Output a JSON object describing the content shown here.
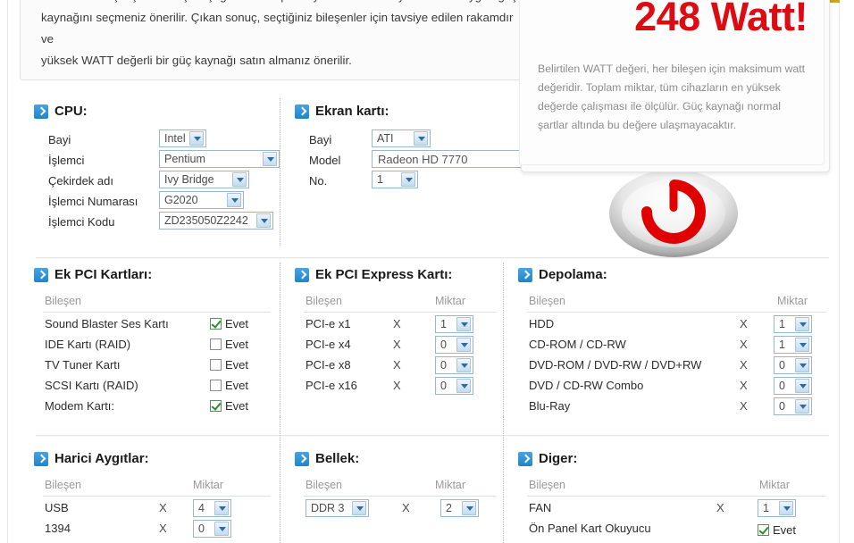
{
  "intro": {
    "text": "sorunlarla karşılaşmamak için aşağıdaki hesaplamayı kullanarak ihtiyacınıza en uygun güç\nkaynağını seçmeniz önerilir. Çıkan sonuç, seçtiğiniz bileşenler için tavsiye edilen rakamdır ve\nyüksek WATT değerli bir güç kaynağı satın almanız önerilir."
  },
  "result": {
    "value": "248 Watt!",
    "note": "Belirtilen WATT değeri, her bileşen için maksimum watt değeridir. Toplam miktar, tüm cihazların en yüksek değerde çalışması ile ölçülür. Güç kaynağı normal şartlar altında bu değere ulaşmayacaktır.",
    "accent_color": "#dd0b12"
  },
  "cpu": {
    "title": "CPU:",
    "rows": [
      {
        "label": "Bayi",
        "value": "Intel"
      },
      {
        "label": "İşlemci",
        "value": "Pentium"
      },
      {
        "label": "Çekirdek adı",
        "value": "Ivy Bridge"
      },
      {
        "label": "İşlemci Numarası",
        "value": "G2020"
      },
      {
        "label": "İşlemci Kodu",
        "value": "ZD235050Z2242"
      }
    ]
  },
  "gpu": {
    "title": "Ekran kartı:",
    "rows": [
      {
        "label": "Bayi",
        "value": "ATI"
      },
      {
        "label": "Model",
        "value": "Radeon HD 7770"
      },
      {
        "label": "No.",
        "value": "1"
      }
    ]
  },
  "pci": {
    "title": "Ek PCI Kartları:",
    "head_component": "Bileşen",
    "yes_label": "Evet",
    "rows": [
      {
        "label": "Sound Blaster Ses Kartı",
        "checked": true
      },
      {
        "label": "IDE Kartı (RAID)",
        "checked": false
      },
      {
        "label": "TV Tuner Kartı",
        "checked": false
      },
      {
        "label": "SCSI Kartı (RAID)",
        "checked": false
      },
      {
        "label": "Modem Kartı:",
        "checked": true
      }
    ]
  },
  "pcie": {
    "title": "Ek PCI Express Kartı:",
    "head_component": "Bileşen",
    "head_qty": "Miktar",
    "x_symbol": "X",
    "rows": [
      {
        "label": "PCI-e x1",
        "qty": "1"
      },
      {
        "label": "PCI-e x4",
        "qty": "0"
      },
      {
        "label": "PCI-e x8",
        "qty": "0"
      },
      {
        "label": "PCI-e x16",
        "qty": "0"
      }
    ]
  },
  "storage": {
    "title": "Depolama:",
    "head_component": "Bileşen",
    "head_qty": "Miktar",
    "x_symbol": "X",
    "rows": [
      {
        "label": "HDD",
        "qty": "1"
      },
      {
        "label": "CD-ROM / CD-RW",
        "qty": "1"
      },
      {
        "label": "DVD-ROM / DVD-RW / DVD+RW",
        "qty": "0"
      },
      {
        "label": "DVD / CD-RW Combo",
        "qty": "0"
      },
      {
        "label": "Blu-Ray",
        "qty": "0"
      }
    ]
  },
  "external": {
    "title": "Harici Aygıtlar:",
    "head_component": "Bileşen",
    "head_qty": "Miktar",
    "x_symbol": "X",
    "rows": [
      {
        "label": "USB",
        "qty": "4"
      },
      {
        "label": "1394",
        "qty": "0"
      }
    ]
  },
  "memory": {
    "title": "Bellek:",
    "head_component": "Bileşen",
    "head_qty": "Miktar",
    "x_symbol": "X",
    "type_value": "DDR 3",
    "qty_value": "2"
  },
  "other": {
    "title": "Diger:",
    "head_component": "Bileşen",
    "head_qty": "Miktar",
    "x_symbol": "X",
    "yes_label": "Evet",
    "fan_label": "FAN",
    "fan_qty": "1",
    "reader_label": "Ön Panel Kart Okuyucu",
    "reader_checked": true
  }
}
